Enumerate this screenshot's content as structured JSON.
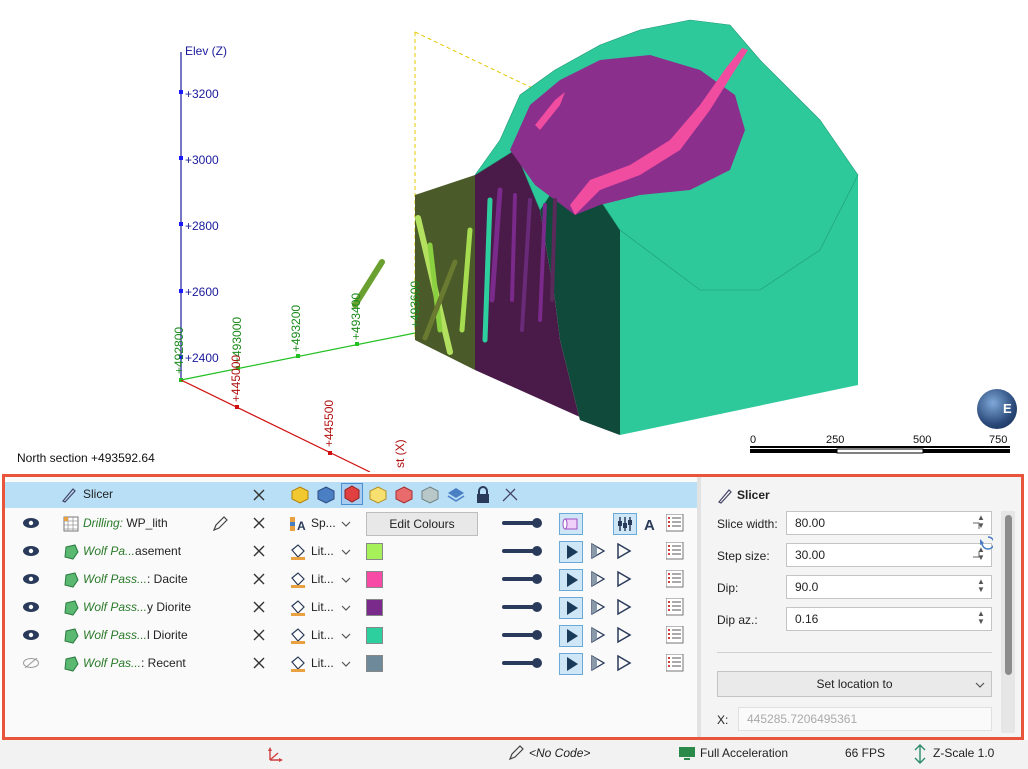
{
  "viewport": {
    "axis_z_label": "Elev (Z)",
    "z_ticks": [
      "+3200",
      "+3000",
      "+2800",
      "+2600",
      "+2400"
    ],
    "y_ticks": [
      "+492800",
      "+493000",
      "+493200",
      "+493400",
      "+493600"
    ],
    "x_ticks": [
      "+445000",
      "+445500"
    ],
    "x_axis_label_partial": "st (X)",
    "section_label": "North section +493592.64",
    "scale_labels": [
      "0",
      "250",
      "500",
      "750"
    ],
    "compass_letter": "E",
    "colors": {
      "teal_surface": "#2ec99a",
      "purple_unit": "#8a2f8c",
      "pink_dyke": "#f04ca0",
      "olive_face": "#4a5a2a",
      "dark_purple_face": "#4a1a48",
      "dark_green_face": "#0f4a3a"
    }
  },
  "panel": {
    "header": {
      "label": "Slicer"
    },
    "rows": [
      {
        "italic": "Drilling:",
        "rest": " WP_lith",
        "lit": "Sp...",
        "action": "Edit Colours",
        "swatch": null,
        "visible": true
      },
      {
        "italic": "Wolf Pa...",
        "rest": "asement",
        "lit": "Lit...",
        "action": null,
        "swatch": "#a6f05a",
        "visible": true
      },
      {
        "italic": "Wolf Pass...",
        "rest": ": Dacite",
        "lit": "Lit...",
        "action": null,
        "swatch": "#f64aa6",
        "visible": true
      },
      {
        "italic": "Wolf Pass...",
        "rest": "y Diorite",
        "lit": "Lit...",
        "action": null,
        "swatch": "#7a2a8a",
        "visible": true
      },
      {
        "italic": "Wolf Pass...",
        "rest": "l Diorite",
        "lit": "Lit...",
        "action": null,
        "swatch": "#2ecf9e",
        "visible": true
      },
      {
        "italic": "Wolf Pas...",
        "rest": ": Recent",
        "lit": "Lit...",
        "action": null,
        "swatch": "#6e8a9a",
        "visible": false
      }
    ]
  },
  "slicer": {
    "title": "Slicer",
    "slice_width_label": "Slice width:",
    "slice_width": "80.00",
    "step_size_label": "Step size:",
    "step_size": "30.00",
    "dip_label": "Dip:",
    "dip": "90.0",
    "dip_az_label": "Dip az.:",
    "dip_az": "0.16",
    "set_location": "Set location to",
    "x_label": "X:",
    "x_value": "445285.7206495361"
  },
  "status": {
    "no_code": "<No Code>",
    "acceleration": "Full Acceleration",
    "fps": "66 FPS",
    "zscale": "Z-Scale 1.0"
  }
}
